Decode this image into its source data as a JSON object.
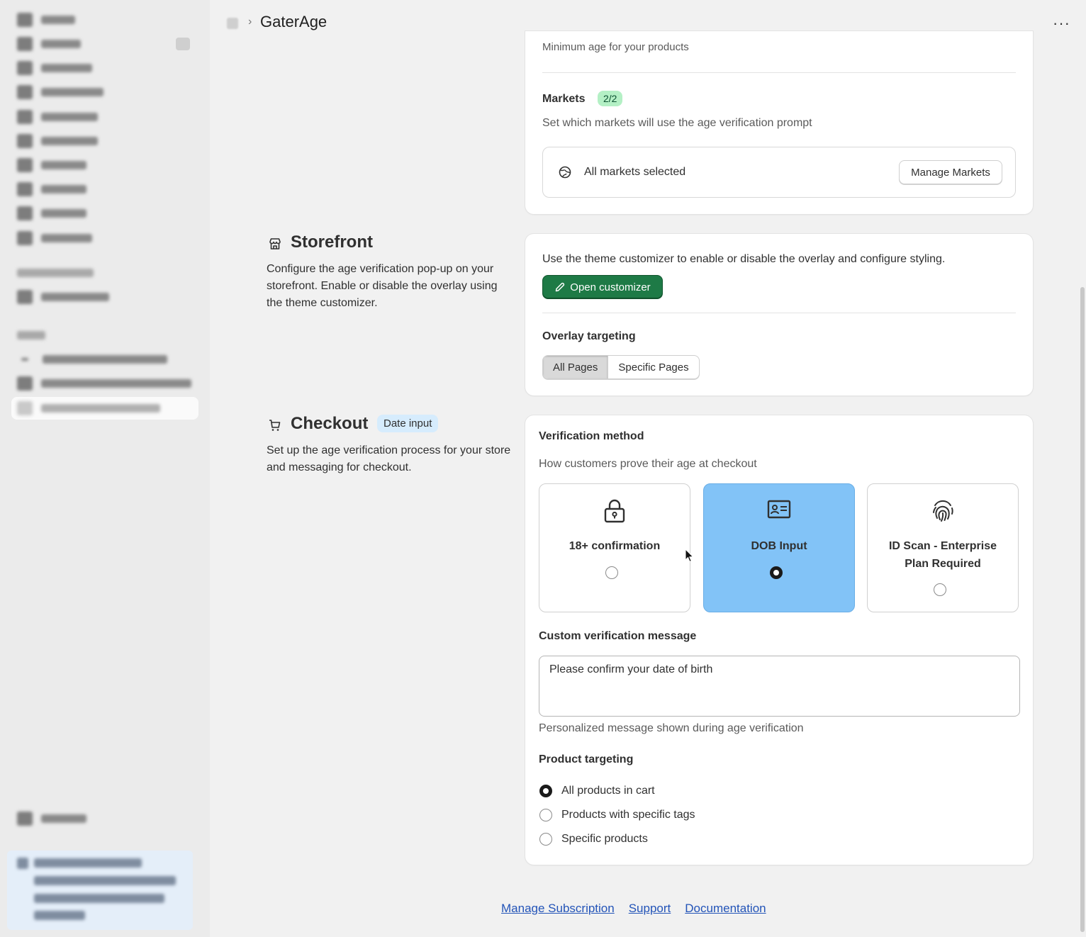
{
  "header": {
    "app_title": "GaterAge",
    "breadcrumb_separator": "›",
    "more_label": "···"
  },
  "markets": {
    "cutoff_text": "Minimum age for your products",
    "title": "Markets",
    "badge": "2/2",
    "description": "Set which markets will use the age verification prompt",
    "status": "All markets selected",
    "manage_button": "Manage Markets"
  },
  "storefront": {
    "title": "Storefront",
    "description": "Configure the age verification pop-up on your storefront. Enable or disable the overlay using the theme customizer.",
    "customizer_text": "Use the theme customizer to enable or disable the overlay and configure styling.",
    "open_customizer_button": "Open customizer",
    "overlay_title": "Overlay targeting",
    "overlay_options": [
      "All Pages",
      "Specific Pages"
    ],
    "overlay_selected": "All Pages"
  },
  "checkout": {
    "title": "Checkout",
    "badge": "Date input",
    "description": "Set up the age verification process for your store and messaging for checkout.",
    "method_title": "Verification method",
    "method_description": "How customers prove their age at checkout",
    "methods": [
      {
        "label": "18+ confirmation",
        "icon": "lock-icon",
        "selected": false
      },
      {
        "label": "DOB Input",
        "icon": "id-card-icon",
        "selected": true
      },
      {
        "label": "ID Scan - Enterprise Plan Required",
        "icon": "fingerprint-icon",
        "selected": false
      }
    ],
    "message_title": "Custom verification message",
    "message_value": "Please confirm your date of birth",
    "message_help": "Personalized message shown during age verification",
    "product_title": "Product targeting",
    "product_options": [
      {
        "label": "All products in cart",
        "selected": true
      },
      {
        "label": "Products with specific tags",
        "selected": false
      },
      {
        "label": "Specific products",
        "selected": false
      }
    ]
  },
  "footer": {
    "links": [
      "Manage Subscription",
      "Support",
      "Documentation"
    ]
  },
  "colors": {
    "primary_button": "#1e7a46",
    "selected_method": "#82c3f7",
    "badge_green": "#b4f0c5",
    "badge_blue": "#d6ecfd",
    "link": "#2354b8"
  }
}
